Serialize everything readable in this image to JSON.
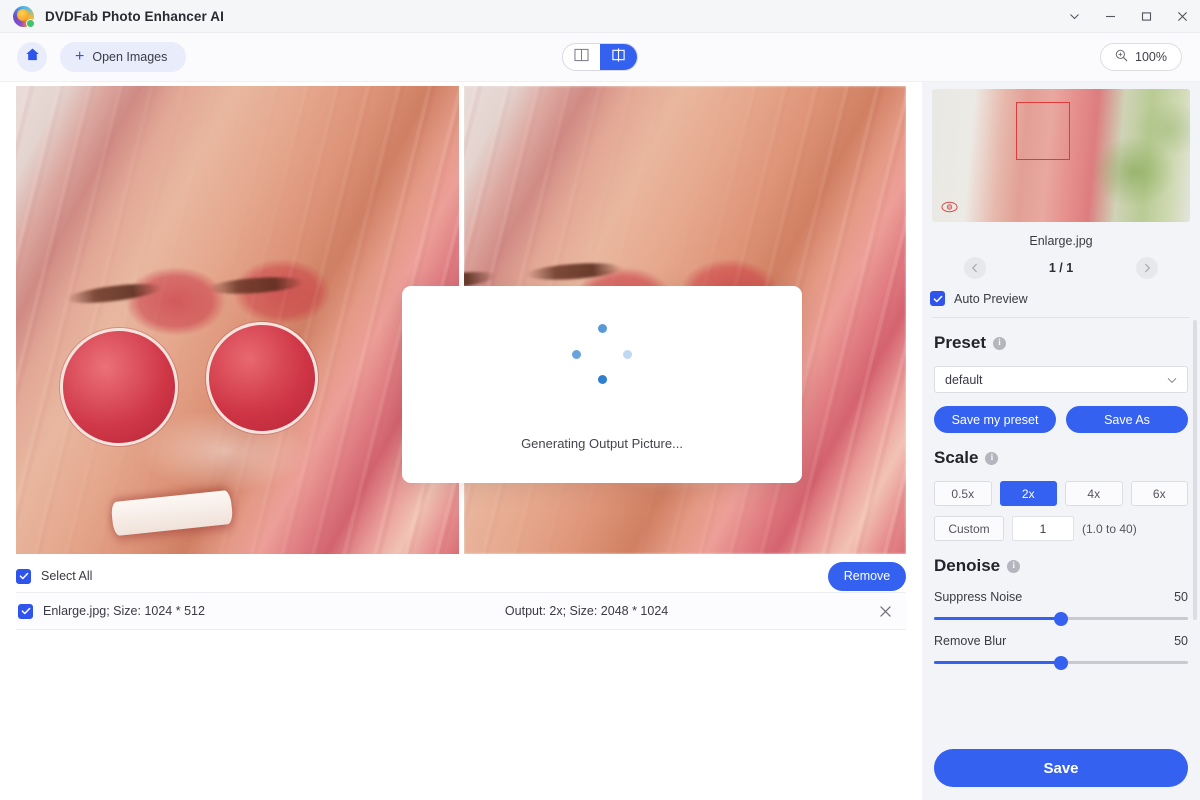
{
  "titlebar": {
    "app_title": "DVDFab Photo Enhancer AI",
    "logo_icon": "dvdfab-logo-icon",
    "controls": [
      {
        "name": "menu-chevron-down-button",
        "icon": "chevron-down-icon"
      },
      {
        "name": "minimize-button",
        "icon": "minimize-icon"
      },
      {
        "name": "maximize-button",
        "icon": "maximize-icon"
      },
      {
        "name": "close-button",
        "icon": "close-icon"
      }
    ]
  },
  "toolbar": {
    "home_icon": "home-icon",
    "open_images_label": "Open Images",
    "open_images_plus": "+",
    "view_modes": [
      {
        "name": "tab-split-view",
        "icon": "split-view-icon",
        "active": false
      },
      {
        "name": "tab-compare-view",
        "icon": "compare-view-icon",
        "active": true
      }
    ],
    "zoom_icon": "zoom-in-icon",
    "zoom_level": "100%"
  },
  "preview": {
    "loading_text": "Generating Output Picture...",
    "spinner_icon": "loading-dots-spinner"
  },
  "filelist": {
    "select_all_label": "Select All",
    "select_all_checked": true,
    "remove_label": "Remove",
    "rows": [
      {
        "checked": true,
        "name": "Enlarge.jpg; Size: 1024 * 512",
        "output": "Output: 2x; Size: 2048 * 1024",
        "close_icon": "close-icon"
      }
    ]
  },
  "sidebar": {
    "thumbnail": {
      "filename": "Enlarge.jpg",
      "eye_icon": "preview-eye-icon",
      "selection_rect": true
    },
    "pager": {
      "prev_icon": "chevron-left-icon",
      "next_icon": "chevron-right-icon",
      "count": "1 / 1"
    },
    "auto_preview": {
      "label": "Auto Preview",
      "checked": true
    },
    "preset": {
      "title": "Preset",
      "info_icon": "info-icon",
      "selected": "default",
      "caret_icon": "chevron-down-icon",
      "save_my_preset_label": "Save my preset",
      "save_as_label": "Save As"
    },
    "scale": {
      "title": "Scale",
      "info_icon": "info-icon",
      "options": [
        {
          "label": "0.5x",
          "active": false
        },
        {
          "label": "2x",
          "active": true
        },
        {
          "label": "4x",
          "active": false
        },
        {
          "label": "6x",
          "active": false
        }
      ],
      "custom_label": "Custom",
      "custom_value": "1",
      "custom_hint": "(1.0 to 40)"
    },
    "denoise": {
      "title": "Denoise",
      "info_icon": "info-icon",
      "sliders": [
        {
          "label": "Suppress Noise",
          "value": "50",
          "percent": 50
        },
        {
          "label": "Remove Blur",
          "value": "50",
          "percent": 50
        }
      ]
    },
    "save_label": "Save"
  },
  "colors": {
    "accent_blue": "#3461f0",
    "accent_blue_dark": "#2f54eb",
    "sidebar_bg": "#f3f4f7",
    "titlebar_bg": "#f5f6f8",
    "selection_red": "#e03a3a"
  }
}
